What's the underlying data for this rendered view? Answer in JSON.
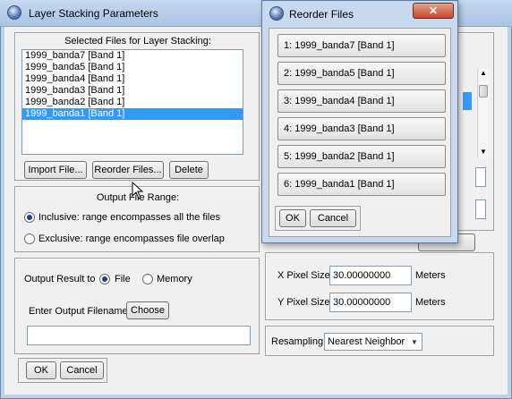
{
  "main_window": {
    "title": "Layer Stacking Parameters",
    "selected_files": {
      "heading": "Selected Files for Layer Stacking:",
      "items": [
        {
          "label": "1999_banda7 [Band 1]",
          "selected": false
        },
        {
          "label": "1999_banda5 [Band 1]",
          "selected": false
        },
        {
          "label": "1999_banda4 [Band 1]",
          "selected": false
        },
        {
          "label": "1999_banda3 [Band 1]",
          "selected": false
        },
        {
          "label": "1999_banda2 [Band 1]",
          "selected": false
        },
        {
          "label": "1999_banda1 [Band 1]",
          "selected": true
        }
      ],
      "buttons": {
        "import": "Import File...",
        "reorder": "Reorder Files...",
        "delete": "Delete"
      }
    },
    "output_file_range": {
      "heading": "Output File Range:",
      "inclusive": "Inclusive: range encompasses all the files",
      "exclusive": "Exclusive: range encompasses file overlap",
      "selected": "inclusive"
    },
    "output": {
      "label": "Output Result to",
      "file": "File",
      "memory": "Memory",
      "selected": "file",
      "filename_label": "Enter Output Filename",
      "choose": "Choose",
      "filename_value": ""
    },
    "pixel_size": {
      "x_label": "X Pixel Size",
      "x_value": "30.00000000",
      "x_unit": "Meters",
      "y_label": "Y Pixel Size",
      "y_value": "30.00000000",
      "y_unit": "Meters"
    },
    "resampling": {
      "label": "Resampling",
      "value": "Nearest Neighbor"
    },
    "ok": "OK",
    "cancel": "Cancel"
  },
  "reorder_dialog": {
    "title": "Reorder Files",
    "close": "✕",
    "items": [
      "1: 1999_banda7 [Band 1]",
      "2: 1999_banda5 [Band 1]",
      "3: 1999_banda4 [Band 1]",
      "4: 1999_banda3 [Band 1]",
      "5: 1999_banda2 [Band 1]",
      "6: 1999_banda1 [Band 1]"
    ],
    "ok": "OK",
    "cancel": "Cancel"
  }
}
